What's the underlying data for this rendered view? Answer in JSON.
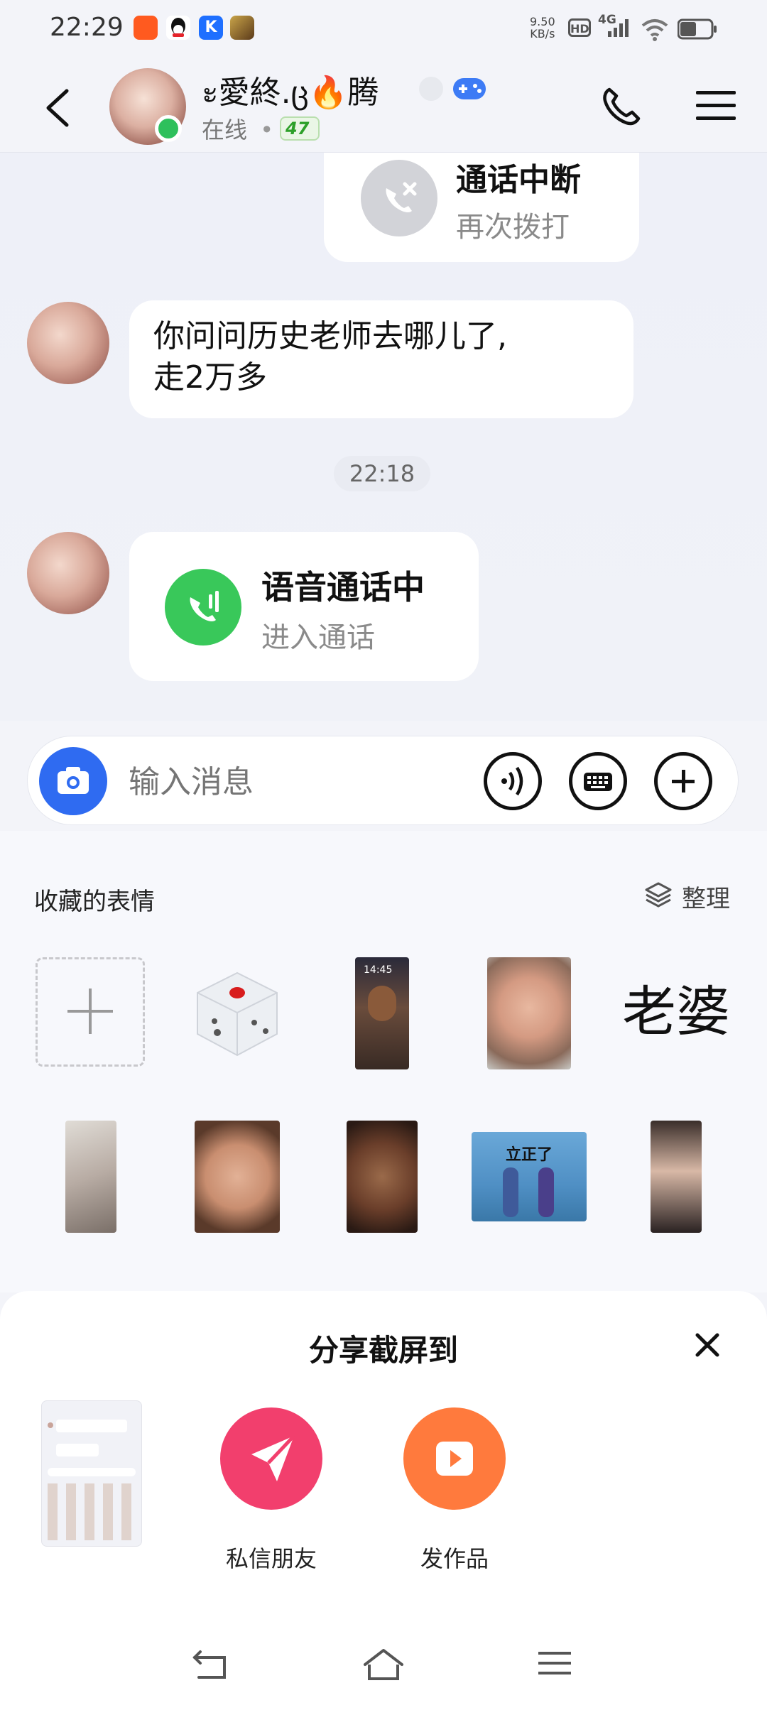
{
  "status_bar": {
    "time": "22:29",
    "net_speed_value": "9.50",
    "net_speed_unit": "KB/s",
    "hd_badge": "HD",
    "network_type": "4G",
    "app_icons": [
      "kuaishou-icon",
      "qq-icon",
      "kuwo-icon",
      "game-icon"
    ]
  },
  "header": {
    "contact_name": "ะ愛終.ც🔥腾",
    "online_status": "在线",
    "level_badge": "47"
  },
  "messages": {
    "call_ended_title": "通话中断",
    "call_ended_action": "再次拨打",
    "text_message": "你问问历史老师去哪儿了,\n走2万多",
    "timestamp": "22:18",
    "voice_call_title": "语音通话中",
    "voice_call_action": "进入通话"
  },
  "input": {
    "placeholder": "输入消息"
  },
  "sticker_panel": {
    "title": "收藏的表情",
    "organize_label": "整理",
    "text_sticker": "老婆",
    "banner_sticker_text": "立正了",
    "clock_sticker_time": "14:45"
  },
  "share_sheet": {
    "title": "分享截屏到",
    "options": [
      {
        "label": "私信朋友",
        "color": "#f23f6d"
      },
      {
        "label": "发作品",
        "color": "#ff7a3d"
      }
    ]
  },
  "colors": {
    "online_green": "#2ec05c",
    "call_green": "#39c85a",
    "camera_blue": "#2f6bf1"
  }
}
